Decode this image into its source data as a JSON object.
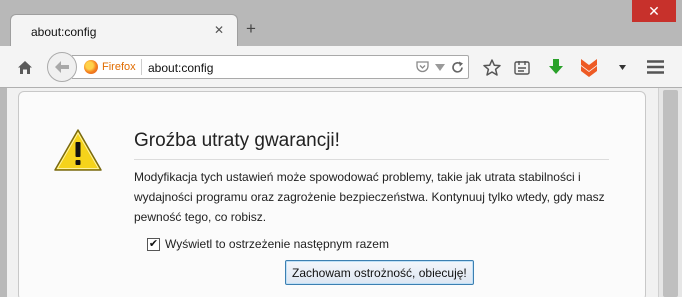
{
  "tabs": [
    {
      "title": "about:config",
      "active": true
    }
  ],
  "window": {
    "close_symbol": "✕",
    "close_color": "#c7312b"
  },
  "navbar": {
    "identity_label": "Firefox",
    "url": "about:config"
  },
  "icons": {
    "home": "home-icon",
    "back": "back-arrow-icon",
    "pocket": "pocket-icon",
    "dropdown": "dropdown-arrow-icon",
    "reload": "reload-icon",
    "bookmark": "star-icon",
    "reading_list": "reading-list-icon",
    "download": "download-icon",
    "extension": "extension-icon",
    "overflow": "chevron-down-icon",
    "menu": "hamburger-menu-icon",
    "warning": "warning-icon"
  },
  "warning_page": {
    "title": "Groźba utraty gwarancji!",
    "message": "Modyfikacja tych ustawień może spowodować problemy, takie jak utrata stabilności i wydajności programu oraz zagrożenie bezpieczeństwa. Kontynuuj tylko wtedy, gdy masz pewność tego, co robisz.",
    "checkbox_label": "Wyświetl to ostrzeżenie następnym razem",
    "checkbox_checked": true,
    "confirm_button": "Zachowam ostrożność, obiecuję!"
  },
  "colors": {
    "accent_border": "#3c7fb1",
    "download_green": "#2aa12a",
    "extension_orange": "#ee5a24",
    "warning_yellow": "#f5d31b"
  }
}
